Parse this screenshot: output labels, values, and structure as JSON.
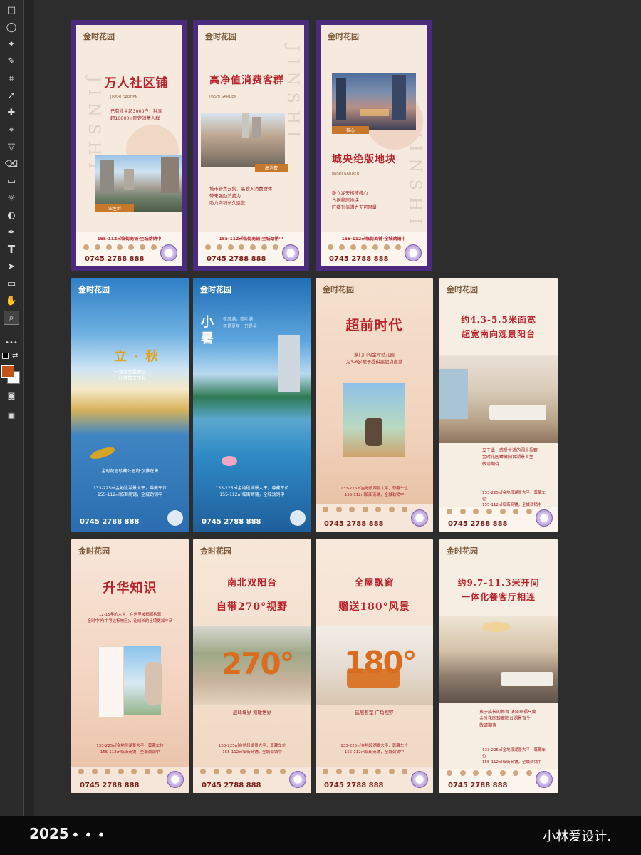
{
  "statusbar": {
    "year": "2025",
    "more": "• • •",
    "author": "小林爱设计."
  },
  "tools": [
    {
      "name": "marquee-tool-icon",
      "glyph": "□"
    },
    {
      "name": "lasso-tool-icon",
      "glyph": "◯"
    },
    {
      "name": "magic-wand-tool-icon",
      "glyph": "✦"
    },
    {
      "name": "brush-tool-icon",
      "glyph": "✎"
    },
    {
      "name": "crop-tool-icon",
      "glyph": "⌗"
    },
    {
      "name": "eyedropper-tool-icon",
      "glyph": "↗"
    },
    {
      "name": "heal-tool-icon",
      "glyph": "✚"
    },
    {
      "name": "stamp-tool-icon",
      "glyph": "⌖"
    },
    {
      "name": "paint-tool-icon",
      "glyph": "▽"
    },
    {
      "name": "eraser-tool-icon",
      "glyph": "⌫"
    },
    {
      "name": "gradient-tool-icon",
      "glyph": "▭"
    },
    {
      "name": "smudge-tool-icon",
      "glyph": "☼"
    },
    {
      "name": "dodge-tool-icon",
      "glyph": "◐"
    },
    {
      "name": "pen-tool-icon",
      "glyph": "✒"
    },
    {
      "name": "type-tool-icon",
      "glyph": "T"
    },
    {
      "name": "selection-tool-icon",
      "glyph": "➤"
    },
    {
      "name": "rectangle-tool-icon",
      "glyph": "▭"
    },
    {
      "name": "hand-tool-icon",
      "glyph": "✋"
    },
    {
      "name": "zoom-tool-icon",
      "glyph": "⌕"
    },
    {
      "name": "more-tools-icon",
      "glyph": "•••"
    }
  ],
  "colors": {
    "foreground": "#c25619",
    "background": "#ffffff",
    "poster_red": "#b8222b"
  },
  "posters": [
    {
      "id": "p1",
      "logo": "金时花园",
      "headline": "万人社区铺",
      "english": "JINSHI GARDEN",
      "lines": [
        "已有业主超3000户，独享",
        "超10000+固定消费人群"
      ],
      "badge": "业主群",
      "promo": "155-112㎡临街商铺·全城劲销中",
      "phone": "0745 2788 888",
      "vertical": "JINSHI"
    },
    {
      "id": "p2",
      "logo": "金时花园",
      "headline": "高净值消费客群",
      "english": "JINSHI GARDEN",
      "lines": [
        "城市新贵云集，高收入消费群体",
        "带来强劲消费力",
        "助力商铺长久运营"
      ],
      "badge": "高消费",
      "promo": "155-112㎡临街商铺·全城劲销中",
      "phone": "0745 2788 888",
      "vertical": "JINSHI"
    },
    {
      "id": "p3",
      "logo": "金时花园",
      "headline": "城央绝版地块",
      "english": "JINSHI GARDEN",
      "lines": [
        "雄立湖天核核核心",
        "占据稳居地块",
        "旺铺升值潜力无可限量"
      ],
      "badge": "核心",
      "promo": "155-112㎡临街商铺·全城劲销中",
      "phone": "0745 2788 888",
      "vertical": "JINSHI"
    },
    {
      "id": "p4",
      "logo": "金时花园",
      "headline": "立·秋",
      "lines": [
        "一湖凉悠看意远",
        "一叶落知天下秋"
      ],
      "caption": "金时花园珍藏公园府·加推在售",
      "promo1": "133-225㎡金地段湖景大平，尊藏车位",
      "promo2": "155-112㎡临街商铺，全城劲销中",
      "phone": "0745 2788 888"
    },
    {
      "id": "p5",
      "logo": "金时花园",
      "headline": "小暑",
      "lines": [
        "荷风满，荷叶满",
        "不是夏至，只是暑"
      ],
      "promo1": "133-225㎡金地段湖景大平，尊藏车位",
      "promo2": "155-112㎡临街商铺，全城劲销中",
      "phone": "0745 2788 888"
    },
    {
      "id": "p6",
      "logo": "金时花园",
      "headline": "超前时代",
      "lines": [
        "家门口的金时幼儿园",
        "为3-6岁孩子提供高起点启蒙"
      ],
      "promo1": "133-225㎡金地段湖景大平，尊藏车位",
      "promo2": "155-112㎡临街商铺，全城劲销中",
      "phone": "0745 2788 888"
    },
    {
      "id": "p7",
      "logo": "金时花园",
      "headline1": "约4.3-5.5米面宽",
      "headline2": "超宽南向观景阳台",
      "lines": [
        "立于此，感受生活的圆景视野",
        "金时花园臻藏阳台湖景官生",
        "敬请期待"
      ],
      "promo1": "133-225㎡金地段湖景大平，尊藏车位",
      "promo2": "155-112㎡临街商铺，全城劲销中",
      "phone": "0745 2788 888"
    },
    {
      "id": "p8",
      "logo": "金时花园",
      "headline": "升华知识",
      "lines": [
        "12-15年的人生，在这里被细腻构筑",
        "金时中学(中考达标校区)，让成长的土壤更加丰沃"
      ],
      "promo1": "133-225㎡金地段湖景大平，尊藏车位",
      "promo2": "155-112㎡临街商铺，全城劲销中",
      "phone": "0745 2788 888"
    },
    {
      "id": "p9",
      "logo": "金时花园",
      "headline1": "南北双阳台",
      "headline2": "自带270°视野",
      "big": "270°",
      "sub": "层峰境界 俯瞰世界",
      "promo1": "133-225㎡金地段湖景大平，尊藏车位",
      "promo2": "155-112㎡临街商铺，全城劲销中",
      "phone": "0745 2788 888"
    },
    {
      "id": "p10",
      "logo": "金时花园",
      "headline1": "全屋飘窗",
      "headline2": "赠送180°风景",
      "big": "180°",
      "sub": "延展卧室 广角视野",
      "promo1": "133-225㎡金地段湖景大平，尊藏车位",
      "promo2": "155-112㎡临街商铺，全城劲销中",
      "phone": "0745 2788 888"
    },
    {
      "id": "p11",
      "logo": "金时花园",
      "headline1": "约9.7-11.3米开间",
      "headline2": "一体化餐客厅相连",
      "lines": [
        "孩子成长的舞台 演绎幸福尺度",
        "金时花园臻藏阳台湖景官生",
        "敬请期待"
      ],
      "promo1": "133-225㎡金地段湖景大平，尊藏车位",
      "promo2": "155-112㎡临街商铺，全城劲销中",
      "phone": "0745 2788 888"
    }
  ]
}
